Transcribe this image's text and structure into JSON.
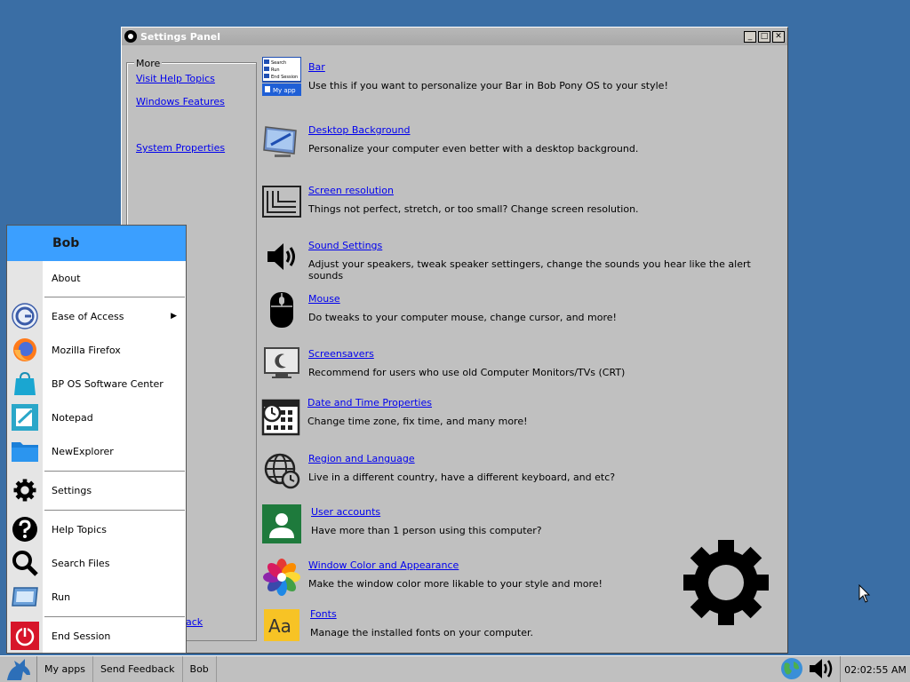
{
  "window": {
    "title": "Settings Panel",
    "minimize": "_",
    "maximize": "□",
    "close": "✕"
  },
  "more": {
    "legend": "More",
    "links": [
      "Visit Help Topics",
      "Windows Features",
      "System Properties"
    ],
    "bottom_link": "ack"
  },
  "settings": [
    {
      "title": "Bar",
      "desc": "Use this if you want to personalize your Bar in Bob Pony OS to your style!",
      "icon": "bar-icon"
    },
    {
      "title": "Desktop Background",
      "desc": "Personalize your computer even better with a desktop background.",
      "icon": "desktop-background-icon"
    },
    {
      "title": "Screen resolution",
      "desc": "Things not perfect, stretch, or too small? Change screen resolution.",
      "icon": "screen-resolution-icon"
    },
    {
      "title": "Sound Settings",
      "desc": "Adjust your speakers, tweak speaker settingers, change the sounds you hear like the alert sounds",
      "icon": "speaker-icon"
    },
    {
      "title": "Mouse",
      "desc": "Do tweaks to your computer mouse, change cursor, and more!",
      "icon": "mouse-icon"
    },
    {
      "title": "Screensavers",
      "desc": "Recommend for users who use old Computer Monitors/TVs (CRT)",
      "icon": "screensaver-icon"
    },
    {
      "title": "Date and Time Properties",
      "desc": "Change time zone, fix time, and many more!",
      "icon": "calendar-clock-icon"
    },
    {
      "title": "Region and Language",
      "desc": "Live in a different country, have a different keyboard, and etc?",
      "icon": "globe-clock-icon"
    },
    {
      "title": "User accounts",
      "desc": "Have more than 1 person using this computer?",
      "icon": "user-icon"
    },
    {
      "title": "Window Color and Appearance",
      "desc": "Make the window color more likable to your style and more!",
      "icon": "color-flower-icon"
    },
    {
      "title": "Fonts",
      "desc": "Manage the installed fonts on your computer.",
      "icon": "fonts-icon"
    }
  ],
  "bar_icon_text": {
    "line1": "Search",
    "line2": "Run",
    "line3": "End Session",
    "line4": "My app"
  },
  "fonts_icon_text": "Aa",
  "startmenu": {
    "user": "Bob",
    "items": [
      "About",
      "Ease of Access",
      "Mozilla Firefox",
      "BP OS Software Center",
      "Notepad",
      "NewExplorer",
      "Settings",
      "Help Topics",
      "Search Files",
      "Run",
      "End Session"
    ],
    "submenu_arrow": "▶"
  },
  "taskbar": {
    "buttons": [
      "My apps",
      "Send Feedback",
      "Bob"
    ],
    "clock": "02:02:55 AM"
  },
  "colors": {
    "desktop": "#3a6ea5",
    "window": "#c0c0c0",
    "menu_header": "#3b9fff",
    "link": "#0000ee"
  }
}
